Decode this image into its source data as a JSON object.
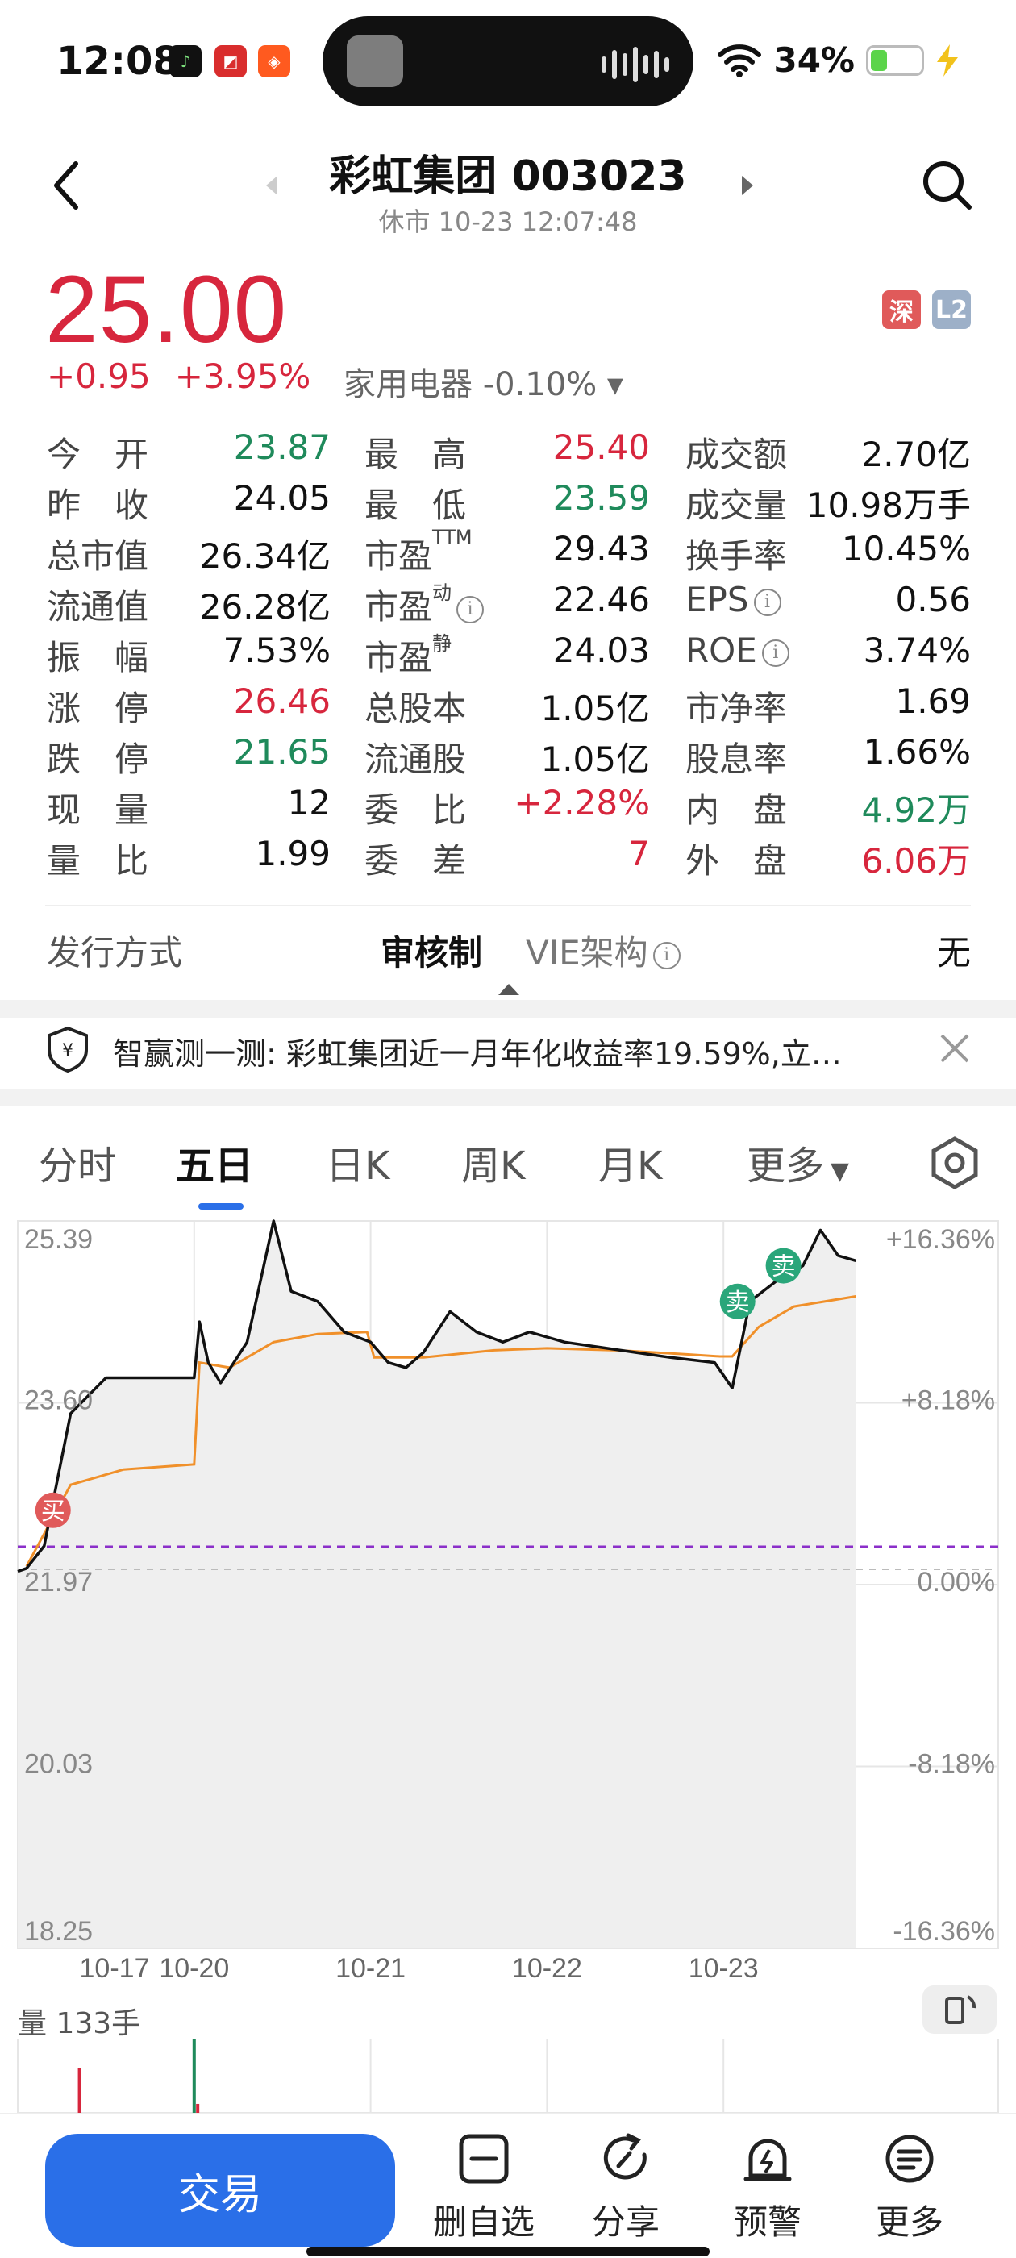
{
  "status_bar": {
    "time": "12:08",
    "battery": "34%",
    "battery_level": 0.34
  },
  "header": {
    "title": "彩虹集团 003023",
    "subtitle": "休市 10-23 12:07:48"
  },
  "quote": {
    "price": "25.00",
    "change": "+0.95",
    "change_pct": "+3.95%",
    "industry": "家用电器 -0.10% ▾",
    "tag_exchange": "深",
    "tag_level": "L2"
  },
  "stats": [
    [
      {
        "label": "今　开",
        "value": "23.87",
        "color": "green"
      },
      {
        "label": "最　高",
        "value": "25.40",
        "color": "red"
      },
      {
        "label": "成交额",
        "value": "2.70亿",
        "color": "black"
      }
    ],
    [
      {
        "label": "昨　收",
        "value": "24.05",
        "color": "black"
      },
      {
        "label": "最　低",
        "value": "23.59",
        "color": "green"
      },
      {
        "label": "成交量",
        "value": "10.98万手",
        "color": "black"
      }
    ],
    [
      {
        "label": "总市值",
        "value": "26.34亿",
        "color": "black"
      },
      {
        "label": "市盈",
        "sup": "TTM",
        "value": "29.43",
        "color": "black"
      },
      {
        "label": "换手率",
        "value": "10.45%",
        "color": "black"
      }
    ],
    [
      {
        "label": "流通值",
        "value": "26.28亿",
        "color": "black"
      },
      {
        "label": "市盈",
        "sup": "动",
        "info": true,
        "value": "22.46",
        "color": "black"
      },
      {
        "label": "EPS",
        "info": true,
        "value": "0.56",
        "color": "black"
      }
    ],
    [
      {
        "label": "振　幅",
        "value": "7.53%",
        "color": "black"
      },
      {
        "label": "市盈",
        "sup": "静",
        "value": "24.03",
        "color": "black"
      },
      {
        "label": "ROE",
        "info": true,
        "value": "3.74%",
        "color": "black"
      }
    ],
    [
      {
        "label": "涨　停",
        "value": "26.46",
        "color": "red"
      },
      {
        "label": "总股本",
        "value": "1.05亿",
        "color": "black"
      },
      {
        "label": "市净率",
        "value": "1.69",
        "color": "black"
      }
    ],
    [
      {
        "label": "跌　停",
        "value": "21.65",
        "color": "green"
      },
      {
        "label": "流通股",
        "value": "1.05亿",
        "color": "black"
      },
      {
        "label": "股息率",
        "value": "1.66%",
        "color": "black"
      }
    ],
    [
      {
        "label": "现　量",
        "value": "12",
        "color": "black"
      },
      {
        "label": "委　比",
        "value": "+2.28%",
        "color": "red"
      },
      {
        "label": "内　盘",
        "value": "4.92万",
        "color": "green"
      }
    ],
    [
      {
        "label": "量　比",
        "value": "1.99",
        "color": "black"
      },
      {
        "label": "委　差",
        "value": "7",
        "color": "red"
      },
      {
        "label": "外　盘",
        "value": "6.06万",
        "color": "red"
      }
    ]
  ],
  "issue": {
    "label": "发行方式",
    "value1": "审核制",
    "value2": "VIE架构",
    "value3": "无"
  },
  "tip": {
    "text": "智赢测一测: 彩虹集团近一月年化收益率19.59%,立…"
  },
  "tabs": [
    "分时",
    "五日",
    "日K",
    "周K",
    "月K",
    "更多"
  ],
  "active_tab": "五日",
  "chart_data": {
    "type": "line",
    "title": "",
    "x_labels": [
      "10-17",
      "10-20",
      "10-21",
      "10-22",
      "10-23"
    ],
    "y_ticks_left": [
      "25.39",
      "23.60",
      "21.97",
      "20.03",
      "18.25"
    ],
    "y_ticks_right": [
      "+16.36%",
      "+8.18%",
      "0.00%",
      "-8.18%",
      "-16.36%"
    ],
    "ylim": [
      18.25,
      25.39
    ],
    "prev_close": 21.97,
    "series": [
      {
        "name": "price",
        "points": [
          [
            0.0,
            21.95
          ],
          [
            0.05,
            21.98
          ],
          [
            0.15,
            22.2
          ],
          [
            0.3,
            23.5
          ],
          [
            0.5,
            23.85
          ],
          [
            1.0,
            23.85
          ],
          [
            1.03,
            24.4
          ],
          [
            1.08,
            24.0
          ],
          [
            1.15,
            23.8
          ],
          [
            1.3,
            24.2
          ],
          [
            1.45,
            25.39
          ],
          [
            1.55,
            24.7
          ],
          [
            1.7,
            24.6
          ],
          [
            1.85,
            24.3
          ],
          [
            2.0,
            24.2
          ],
          [
            2.1,
            24.0
          ],
          [
            2.2,
            23.95
          ],
          [
            2.3,
            24.1
          ],
          [
            2.45,
            24.5
          ],
          [
            2.6,
            24.3
          ],
          [
            2.75,
            24.2
          ],
          [
            2.9,
            24.3
          ],
          [
            3.0,
            24.25
          ],
          [
            3.1,
            24.2
          ],
          [
            3.3,
            24.15
          ],
          [
            3.5,
            24.1
          ],
          [
            3.7,
            24.05
          ],
          [
            3.95,
            24.0
          ],
          [
            4.05,
            23.75
          ],
          [
            4.15,
            24.6
          ],
          [
            4.3,
            24.8
          ],
          [
            4.45,
            24.95
          ],
          [
            4.55,
            25.3
          ],
          [
            4.65,
            25.05
          ],
          [
            4.75,
            25.0
          ]
        ]
      },
      {
        "name": "avg",
        "points": [
          [
            0.05,
            22.0
          ],
          [
            0.3,
            22.8
          ],
          [
            0.6,
            22.95
          ],
          [
            1.0,
            23.0
          ],
          [
            1.03,
            24.0
          ],
          [
            1.2,
            23.95
          ],
          [
            1.45,
            24.2
          ],
          [
            1.7,
            24.28
          ],
          [
            1.98,
            24.3
          ],
          [
            2.02,
            24.05
          ],
          [
            2.3,
            24.05
          ],
          [
            2.7,
            24.12
          ],
          [
            3.0,
            24.14
          ],
          [
            3.4,
            24.12
          ],
          [
            3.8,
            24.08
          ],
          [
            3.98,
            24.06
          ],
          [
            4.05,
            24.06
          ],
          [
            4.2,
            24.35
          ],
          [
            4.4,
            24.55
          ],
          [
            4.75,
            24.65
          ]
        ]
      }
    ],
    "markers": [
      {
        "label": "买",
        "x": 0.2,
        "y": 22.55,
        "color": "#e05a5a"
      },
      {
        "label": "卖",
        "x": 4.08,
        "y": 24.6,
        "color": "#2aa67a"
      },
      {
        "label": "卖",
        "x": 4.34,
        "y": 24.95,
        "color": "#2aa67a"
      }
    ]
  },
  "volume": {
    "label": "量 133手",
    "bars": [
      {
        "x": 0.35,
        "value": 0.6,
        "color": "#d7263d"
      },
      {
        "x": 1.0,
        "value": 1.0,
        "color": "#1f8a5b"
      },
      {
        "x": 1.02,
        "value": 0.12,
        "color": "#d7263d"
      }
    ]
  },
  "bottom_bar": {
    "trade": "交易",
    "items": [
      {
        "label": "删自选",
        "icon": "minus-square-icon"
      },
      {
        "label": "分享",
        "icon": "share-icon"
      },
      {
        "label": "预警",
        "icon": "alarm-icon"
      },
      {
        "label": "更多",
        "icon": "more-icon"
      }
    ]
  },
  "colors": {
    "up": "#d7263d",
    "down": "#1f8a5b",
    "accent": "#2a6fe8",
    "avg_line": "#f0902a",
    "prev_close_line": "#8b2fc9"
  }
}
